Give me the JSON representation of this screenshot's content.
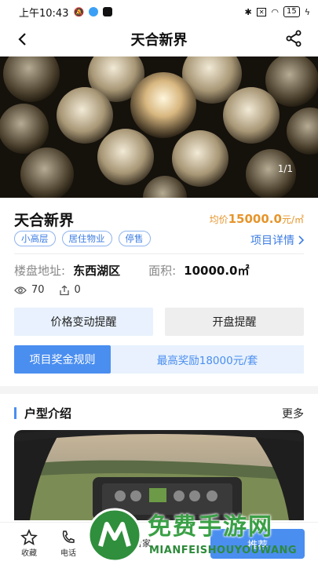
{
  "status_bar": {
    "time": "上午10:43",
    "battery": "15"
  },
  "header": {
    "title": "天合新界"
  },
  "hero": {
    "counter": "1/1"
  },
  "project": {
    "name": "天合新界",
    "price_prefix": "均价",
    "price_value": "15000.0",
    "price_unit": "元/㎡",
    "tags": [
      "小高层",
      "居住物业",
      "停售"
    ],
    "details_link": "项目详情",
    "address_label": "楼盘地址:",
    "address_value": "东西湖区",
    "area_label": "面积:",
    "area_value": "10000.0㎡",
    "views": "70",
    "shares": "0"
  },
  "actions": {
    "price_alert": "价格变动提醒",
    "opening_alert": "开盘提醒",
    "bonus_rules": "项目奖金规则",
    "max_bonus": "最高奖励18000元/套"
  },
  "section": {
    "title": "户型介绍",
    "more": "更多"
  },
  "bottom_bar": {
    "favorite": "收藏",
    "phone": "电话",
    "partial_label": "音家",
    "primary_partial": "推荐"
  },
  "watermark": {
    "main": "免费手游网",
    "sub": "MIANFEISHOUYOUWANG"
  },
  "colors": {
    "accent": "#4a8ef0",
    "price": "#e6952b",
    "tag_text": "#3c7ce3"
  }
}
